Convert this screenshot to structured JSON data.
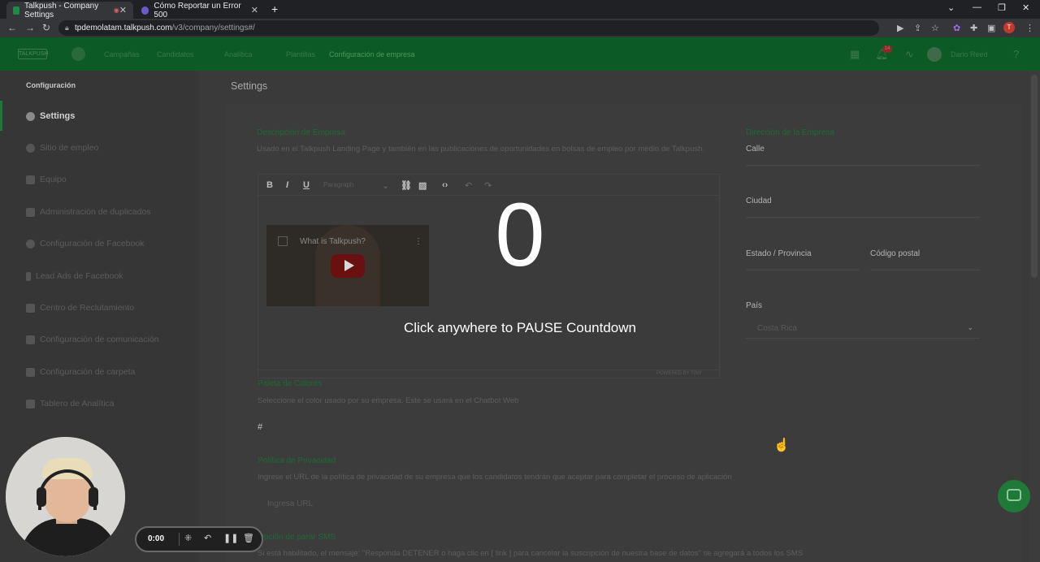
{
  "browser": {
    "tabs": [
      {
        "title": "Talkpush - Company Settings",
        "active": true
      },
      {
        "title": "Cómo Reportar un Error 500",
        "active": false
      }
    ],
    "new_tab": "+",
    "url_host": "tpdemolatam.talkpush.com",
    "url_path": "/v3/company/settings#/",
    "profile_initial": "T"
  },
  "appbar": {
    "logo": "TALKPUSH",
    "nav": [
      "Campañas",
      "Candidatos",
      "Analítica",
      "Plantillas",
      "Configuración de empresa"
    ],
    "notification_count": "14",
    "user_name": "Dario Reed"
  },
  "sidebar": {
    "title": "Configuración",
    "items": [
      {
        "label": "Settings",
        "icon": "gear-icon",
        "active": true
      },
      {
        "label": "Sitio de empleo",
        "icon": "globe-icon"
      },
      {
        "label": "Equipo",
        "icon": "team-icon"
      },
      {
        "label": "Administración de duplicados",
        "icon": "merge-icon"
      },
      {
        "label": "Configuración de Facebook",
        "icon": "facebook-icon"
      },
      {
        "label": "Lead Ads de Facebook",
        "icon": "facebook-f-icon"
      },
      {
        "label": "Centro de Reclutamiento",
        "icon": "building-icon"
      },
      {
        "label": "Configuración de comunicación",
        "icon": "chat-icon"
      },
      {
        "label": "Configuración de carpeta",
        "icon": "folder-icon"
      },
      {
        "label": "Tablero de Analítica",
        "icon": "chart-icon"
      }
    ]
  },
  "main": {
    "page_title": "Settings",
    "company_description": {
      "title": "Descripción de Empresa",
      "desc": "Usado en el Talkpush Landing Page y también en las publicaciones de oportunidades en bolsas de empleo por medio de Talkpush.",
      "paragraph_select": "Paragraph",
      "video_title": "What is Talkpush?",
      "powered_by": "POWERED BY TINY"
    },
    "address": {
      "title": "Dirección de la Empresa",
      "street": "Calle",
      "city": "Ciudad",
      "state": "Estado / Provincia",
      "postal": "Código postal",
      "country_label": "País",
      "country_value": "Costa Rica"
    },
    "palette": {
      "title": "Paleta de Colores",
      "desc": "Seleccione el color usado por su empresa. Este se usará en el Chatbot Web",
      "hash": "#"
    },
    "privacy": {
      "title": "Política de Privacidad",
      "desc": "Ingrese el URL de la política de privacidad de su empresa que los candidatos tendrán que aceptar para completar el proceso de aplicación",
      "placeholder": "Ingresa URL"
    },
    "sms": {
      "title": "Opción de parar SMS",
      "desc": "Si está habilitado, el mensaje: \"Responda DETENER o haga clic en [ link ] para cancelar la suscripción de nuestra base de datos\" se agregará a todos los SMS"
    }
  },
  "overlay": {
    "countdown": "0",
    "hint": "Click anywhere to PAUSE Countdown"
  },
  "recorder": {
    "time": "0:00"
  }
}
